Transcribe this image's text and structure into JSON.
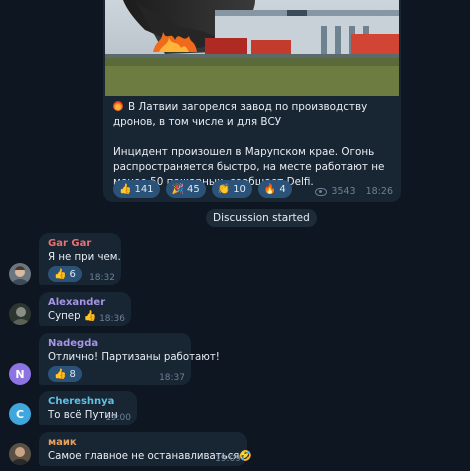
{
  "post": {
    "headline": "В Латвии загорелся завод по производству дронов, в том числе и для ВСУ",
    "body": "Инцидент произошел в Марупском крае. Огонь распространяется быстро, на месте работают не менее 50 пожарных, сообщает Delfi.",
    "reactions": [
      {
        "icon": "thumbs-up-icon",
        "emoji": "👍",
        "count": "141"
      },
      {
        "icon": "party-popper-icon",
        "emoji": "🎉",
        "count": "45"
      },
      {
        "icon": "clapping-hands-icon",
        "emoji": "👏",
        "count": "10"
      },
      {
        "icon": "fire-icon",
        "emoji": "🔥",
        "count": "4"
      }
    ],
    "views": "3543",
    "time": "18:26"
  },
  "discussion_label": "Discussion started",
  "comments": [
    {
      "author": "Gar Gar",
      "author_color": "#e57373",
      "text": "Я не при чем.",
      "reaction_emoji": "👍",
      "reaction_count": "6",
      "time": "18:32"
    },
    {
      "author": "Alexander",
      "author_color": "#a695e7",
      "text": "Супер 👍",
      "time": "18:36"
    },
    {
      "author": "Nadegda",
      "author_color": "#a695e7",
      "avatar_letter": "N",
      "avatar_color": "#8e74e3",
      "text": "Отлично! Партизаны работают!",
      "reaction_emoji": "👍",
      "reaction_count": "8",
      "time": "18:37"
    },
    {
      "author": "Chereshnya",
      "author_color": "#5ec1e6",
      "avatar_letter": "C",
      "avatar_color": "#3fa7dd",
      "text": "То всё Путин",
      "time": "19:00"
    },
    {
      "author": "маик",
      "author_color": "#e6a15c",
      "text": "Самое главное не останавливаться🤣",
      "time": "19:09"
    }
  ]
}
